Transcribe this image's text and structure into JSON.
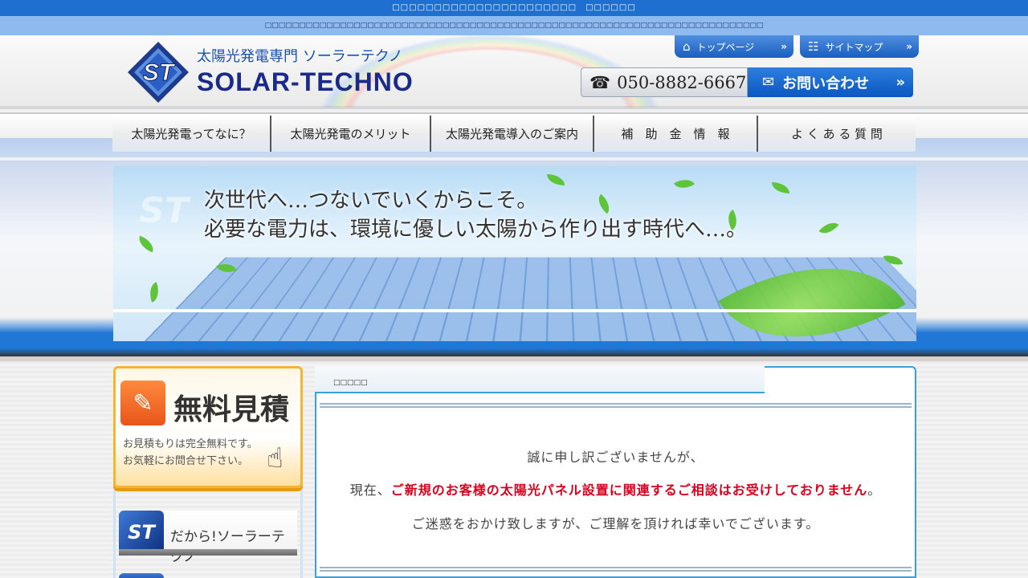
{
  "top_bar": {
    "text": "□□□□□□□□□□□□□□□□□□□□□□　□□□□□□"
  },
  "sub_bar": {
    "text": "□□□□□□□□□□□□□□□□□□□□□□□□□□□□□□□□□□□□□□□□□□□□□□□□□□□□□□□□□□□□□□□□□□□□□□□□□"
  },
  "header": {
    "logo_letters": "ST",
    "logo_subtitle": "太陽光発電専門 ソーラーテクノ",
    "logo_title": "SOLAR-TECHNO",
    "links": [
      {
        "label": "トップページ",
        "icon": "home-icon",
        "glyph": "⌂"
      },
      {
        "label": "サイトマップ",
        "icon": "sitemap-icon",
        "glyph": "☷"
      }
    ],
    "link_arrow": "»",
    "phone": {
      "icon": "phone-icon",
      "glyph": "☎",
      "number": "050-8882-6667"
    },
    "contact": {
      "label": "お問い合わせ",
      "icon": "mail-icon",
      "glyph": "✉",
      "arrow": "»"
    }
  },
  "nav": {
    "items": [
      {
        "label": "太陽光発電ってなに？"
      },
      {
        "label": "太陽光発電のメリット"
      },
      {
        "label": "太陽光発電導入のご案内"
      },
      {
        "label": "補　助　金　情　報"
      },
      {
        "label": "よ く あ る 質 問"
      }
    ]
  },
  "hero": {
    "watermark": "ST",
    "line1": "次世代へ…つないでいくからこそ。",
    "line2": "必要な電力は、環境に優しい太陽から作り出す時代へ…。"
  },
  "sidebar": {
    "estimate": {
      "icon": "document-icon",
      "glyph": "✎",
      "title": "無料見積",
      "text_line1": "お見積もりは完全無料です。",
      "text_line2": "お気軽にお問合せ下さい。",
      "cursor_glyph": "☝"
    },
    "dakara": {
      "logo": "ST",
      "label": "だから!ソーラーテクノ"
    }
  },
  "main": {
    "title": "□□□□□",
    "message1": "誠に申し訳ございませんが、",
    "message2_prefix": "現在、",
    "message2_red": "ご新規のお客様の太陽光パネル設置に関連するご相談はお受けしておりません",
    "message2_suffix": "。",
    "message3": "ご迷惑をおかけ致しますが、ご理解を頂ければ幸いでございます。"
  },
  "colors": {
    "brand_blue": "#1f6fd0",
    "accent_orange": "#f5b533",
    "alert_red": "#d8001c"
  }
}
